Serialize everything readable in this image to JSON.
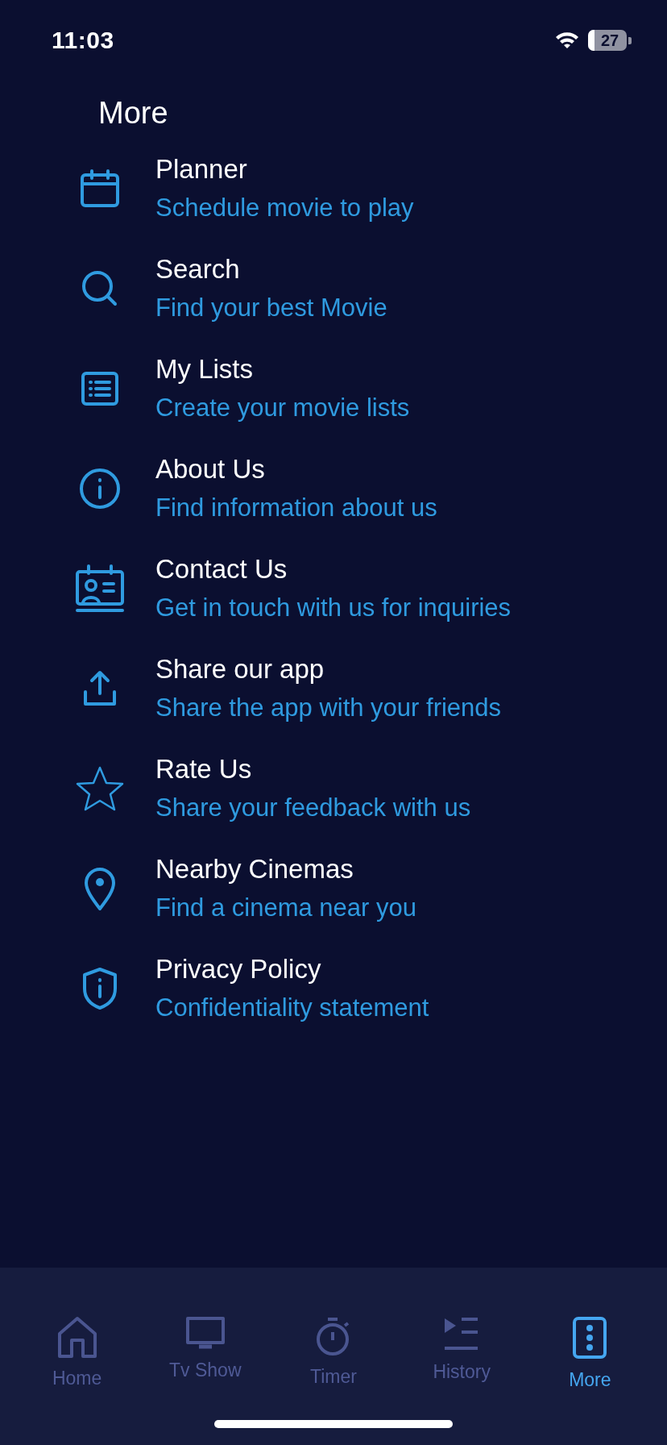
{
  "status_bar": {
    "time": "11:03",
    "battery": "27"
  },
  "title": "More",
  "items": [
    {
      "kind": "calendar",
      "title": "Planner",
      "subtitle": "Schedule movie to play"
    },
    {
      "kind": "search",
      "title": "Search",
      "subtitle": "Find your best Movie"
    },
    {
      "kind": "list",
      "title": "My Lists",
      "subtitle": "Create your movie lists"
    },
    {
      "kind": "info",
      "title": "About Us",
      "subtitle": "Find information about us"
    },
    {
      "kind": "contact",
      "title": "Contact Us",
      "subtitle": "Get in touch with us for inquiries"
    },
    {
      "kind": "share",
      "title": "Share our app",
      "subtitle": "Share the app with your friends"
    },
    {
      "kind": "star",
      "title": "Rate Us",
      "subtitle": "Share your feedback with us"
    },
    {
      "kind": "pin",
      "title": "Nearby Cinemas",
      "subtitle": "Find a cinema near you"
    },
    {
      "kind": "shield",
      "title": "Privacy Policy",
      "subtitle": "Confidentiality statement"
    }
  ],
  "tab_bar": [
    {
      "kind": "home",
      "label": "Home",
      "selected": false
    },
    {
      "kind": "tv",
      "label": "Tv Show",
      "selected": false
    },
    {
      "kind": "timer",
      "label": "Timer",
      "selected": false
    },
    {
      "kind": "history",
      "label": "History",
      "selected": false
    },
    {
      "kind": "more",
      "label": "More",
      "selected": true
    }
  ]
}
